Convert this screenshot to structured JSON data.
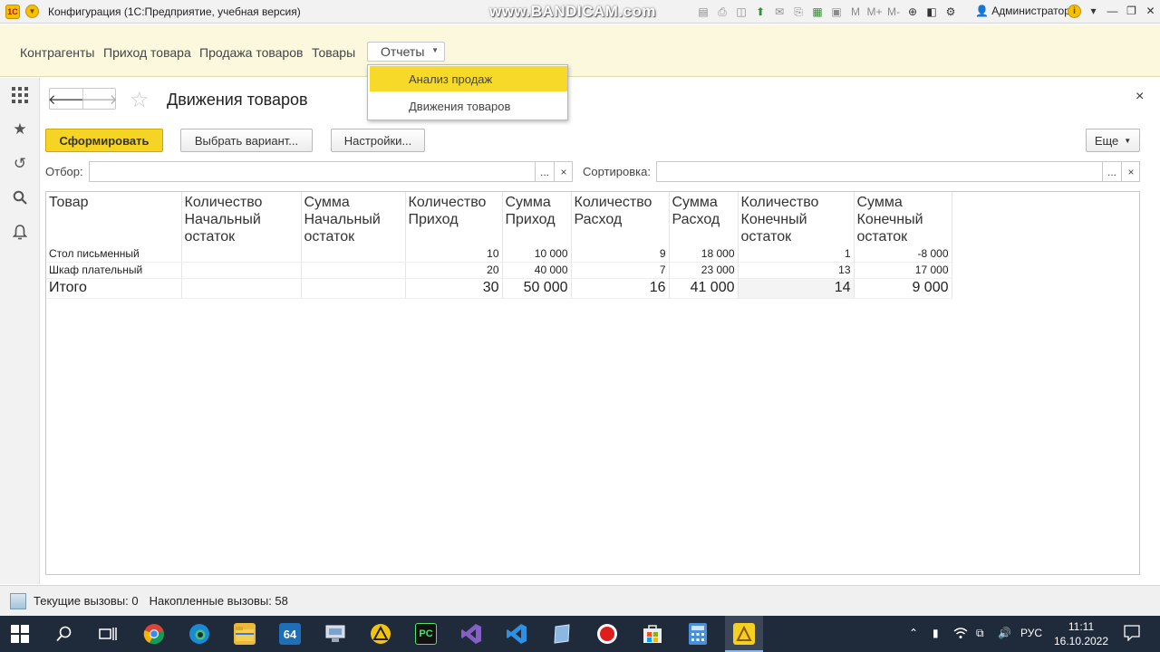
{
  "window": {
    "title": "Конфигурация  (1С:Предприятие, учебная версия)",
    "watermark": "www.BANDICAM.com",
    "user": "Администратор"
  },
  "sections": {
    "items": [
      "Контрагенты",
      "Приход товара",
      "Продажа товаров",
      "Товары"
    ],
    "reports_label": "Отчеты"
  },
  "dropdown": {
    "items": [
      "Анализ продаж",
      "Движения товаров"
    ],
    "active_index": 0
  },
  "form": {
    "title": "Движения товаров",
    "generate_button": "Сформировать",
    "variant_button": "Выбрать вариант...",
    "settings_button": "Настройки...",
    "more_button": "Еще",
    "filter_label": "Отбор:",
    "filter_value": "",
    "sort_label": "Сортировка:",
    "sort_value": "",
    "field_select": "...",
    "field_clear": "×",
    "close": "×"
  },
  "report": {
    "columns": [
      [
        "Товар"
      ],
      [
        "Количество",
        "Начальный",
        "остаток"
      ],
      [
        "Сумма",
        "Начальный",
        "остаток"
      ],
      [
        "Количество",
        "Приход"
      ],
      [
        "Сумма",
        "Приход"
      ],
      [
        "Количество",
        "Расход"
      ],
      [
        "Сумма",
        "Расход"
      ],
      [
        "Количество",
        "Конечный",
        "остаток"
      ],
      [
        "Сумма",
        "Конечный",
        "остаток"
      ]
    ],
    "rows": [
      [
        "Стол письменный",
        "",
        "",
        "10",
        "10 000",
        "9",
        "18 000",
        "1",
        "-8 000"
      ],
      [
        "Шкаф плательный",
        "",
        "",
        "20",
        "40 000",
        "7",
        "23 000",
        "13",
        "17 000"
      ]
    ],
    "total": [
      "Итого",
      "",
      "",
      "30",
      "50 000",
      "16",
      "41 000",
      "14",
      "9 000"
    ]
  },
  "status": {
    "current_calls": "Текущие вызовы: 0",
    "accumulated_calls": "Накопленные вызовы: 58"
  },
  "taskbar": {
    "lang": "РУС",
    "time": "11:11",
    "date": "16.10.2022",
    "app_64": "64",
    "app_pc": "PC"
  }
}
